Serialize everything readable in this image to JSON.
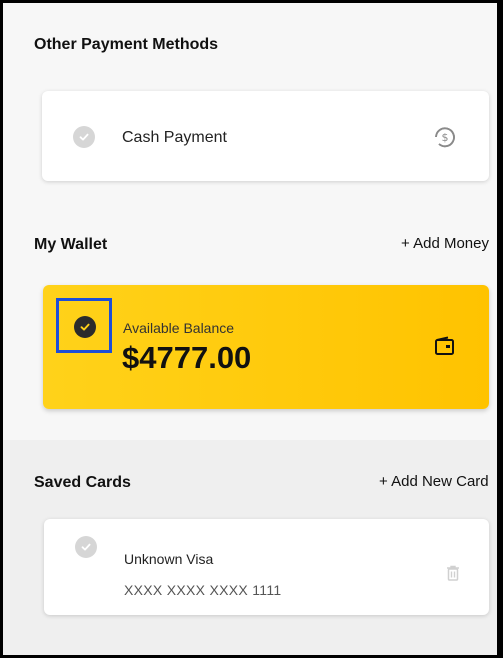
{
  "other_methods": {
    "title": "Other Payment Methods",
    "items": [
      {
        "label": "Cash Payment",
        "icon": "cash-icon"
      }
    ]
  },
  "wallet": {
    "title": "My Wallet",
    "add_label": "+ Add Money",
    "balance_label": "Available Balance",
    "balance_value": "$4777.00",
    "icon": "wallet-icon",
    "selected": true
  },
  "saved_cards": {
    "title": "Saved Cards",
    "add_label": "+ Add New Card",
    "cards": [
      {
        "name": "Unknown Visa",
        "number": "XXXX XXXX XXXX 1111",
        "icon": "trash-icon"
      }
    ]
  },
  "colors": {
    "accent_yellow": "#ffc90a",
    "selection_outline": "#1d4ed8",
    "check_dark": "#2b2b2b",
    "check_grey": "#d6d6d6"
  }
}
